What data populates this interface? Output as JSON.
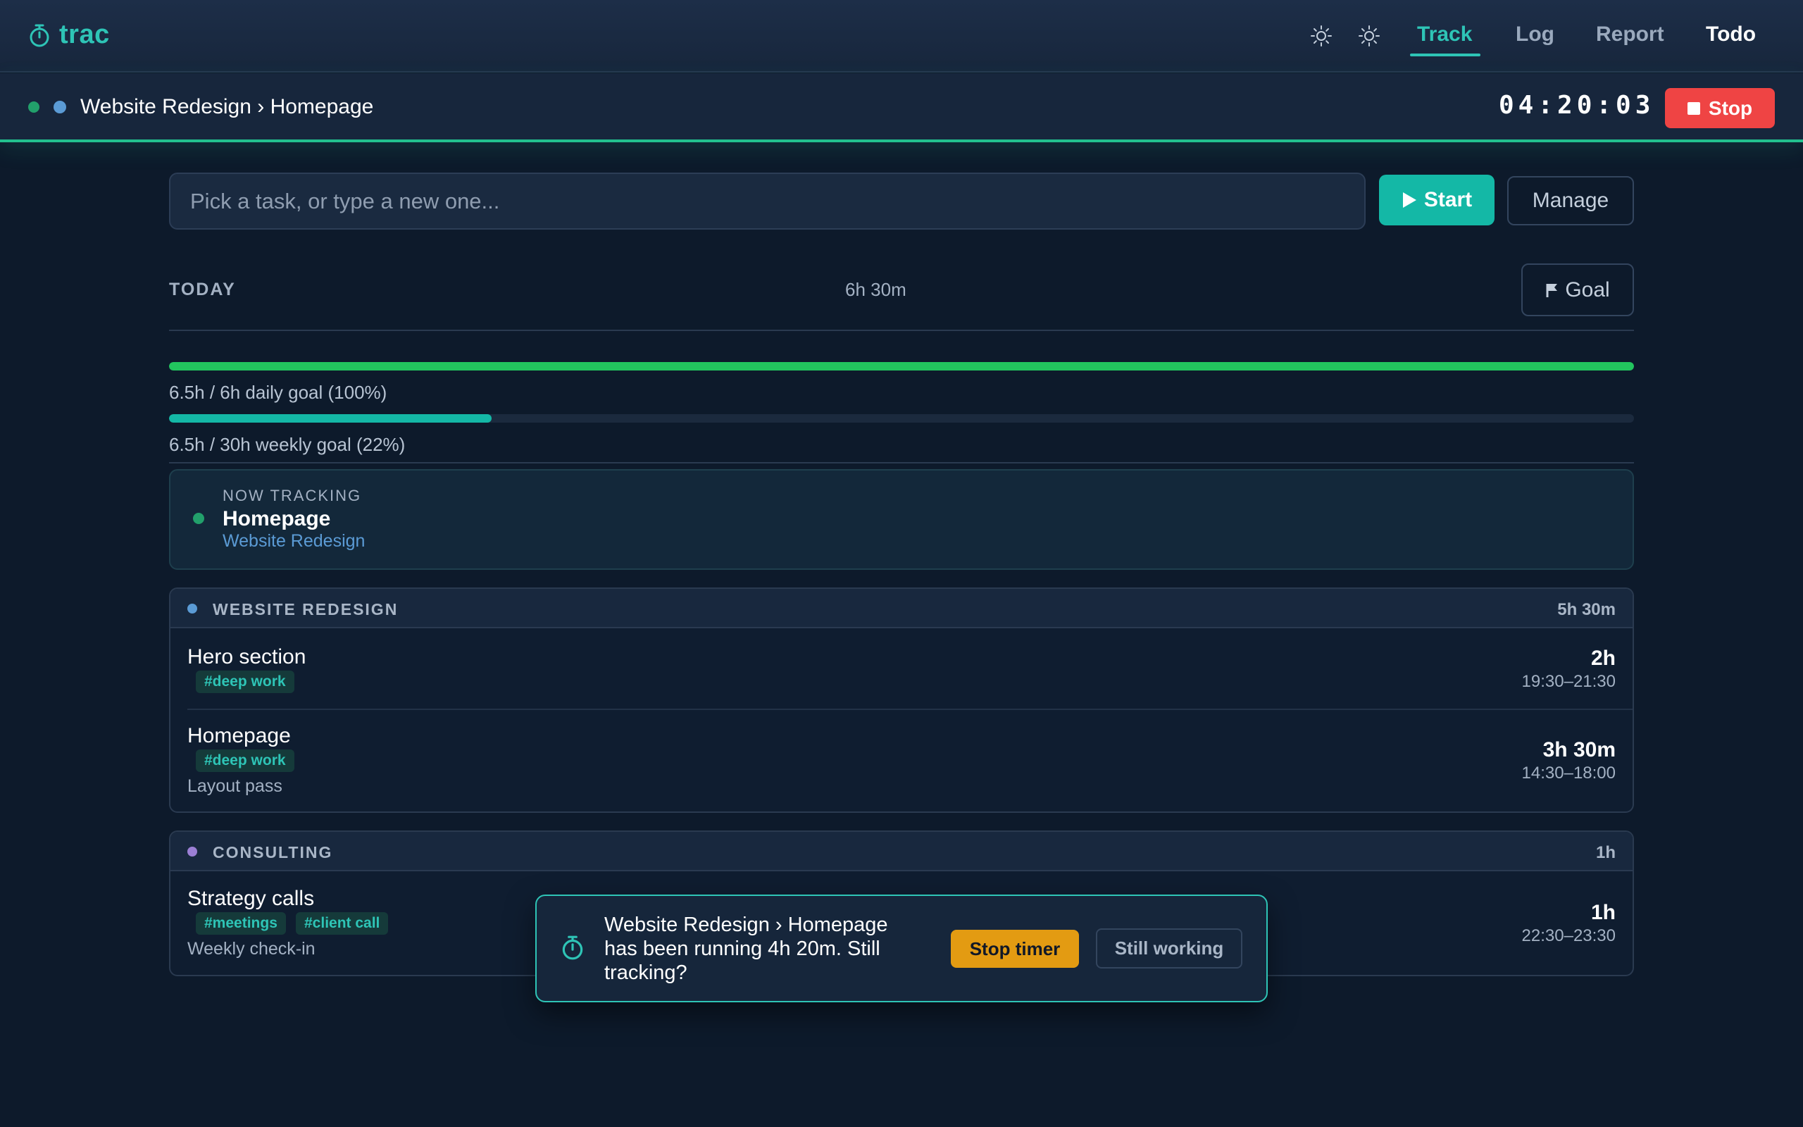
{
  "app": {
    "name": "trac",
    "icon": "stopwatch-icon",
    "accent": "#2ec4b6"
  },
  "nav": {
    "theme_icons": [
      "sun-icon",
      "sun-icon"
    ],
    "links": [
      {
        "label": "Track",
        "active": true
      },
      {
        "label": "Log",
        "active": false
      },
      {
        "label": "Report",
        "active": false
      },
      {
        "label": "Todo",
        "active": false
      }
    ]
  },
  "tracking_bar": {
    "status_color": "#22a06b",
    "project_color": "#5b9bd5",
    "title": "Website Redesign › Homepage",
    "elapsed": "04:20:03",
    "stop_label": "Stop",
    "stop_color": "#ef4444"
  },
  "task_entry": {
    "placeholder": "Pick a task, or type a new one...",
    "value": "",
    "start_label": "Start",
    "manage_label": "Manage"
  },
  "today": {
    "label": "TODAY",
    "total": "6h 30m",
    "goal_label": "Goal",
    "daily_goal": {
      "label": "6.5h / 6h daily goal (100%)",
      "progress": 1.0,
      "color": "#22c55e"
    },
    "weekly_goal": {
      "label": "6.5h / 30h weekly goal (22%)",
      "progress": 0.22,
      "color": "#14b8a6"
    }
  },
  "now_tracking": {
    "kicker": "NOW TRACKING",
    "task": "Homepage",
    "project": "Website Redesign"
  },
  "groups": [
    {
      "name": "WEBSITE REDESIGN",
      "color": "#5b9bd5",
      "total": "5h 30m",
      "entries": [
        {
          "title": "Hero section",
          "tags": [
            "#deep work"
          ],
          "note": "",
          "duration": "2h",
          "range": "19:30–21:30"
        },
        {
          "title": "Homepage",
          "tags": [
            "#deep work"
          ],
          "note": "Layout pass",
          "duration": "3h 30m",
          "range": "14:30–18:00"
        }
      ]
    },
    {
      "name": "CONSULTING",
      "color": "#9b7fd4",
      "total": "1h",
      "entries": [
        {
          "title": "Strategy calls",
          "tags": [
            "#meetings",
            "#client call"
          ],
          "note": "Weekly check-in",
          "duration": "1h",
          "range": "22:30–23:30"
        }
      ]
    }
  ],
  "toast": {
    "message": "Website Redesign › Homepage has been running 4h 20m. Still tracking?",
    "stop_label": "Stop timer",
    "continue_label": "Still working",
    "stop_color": "#e39b12"
  }
}
